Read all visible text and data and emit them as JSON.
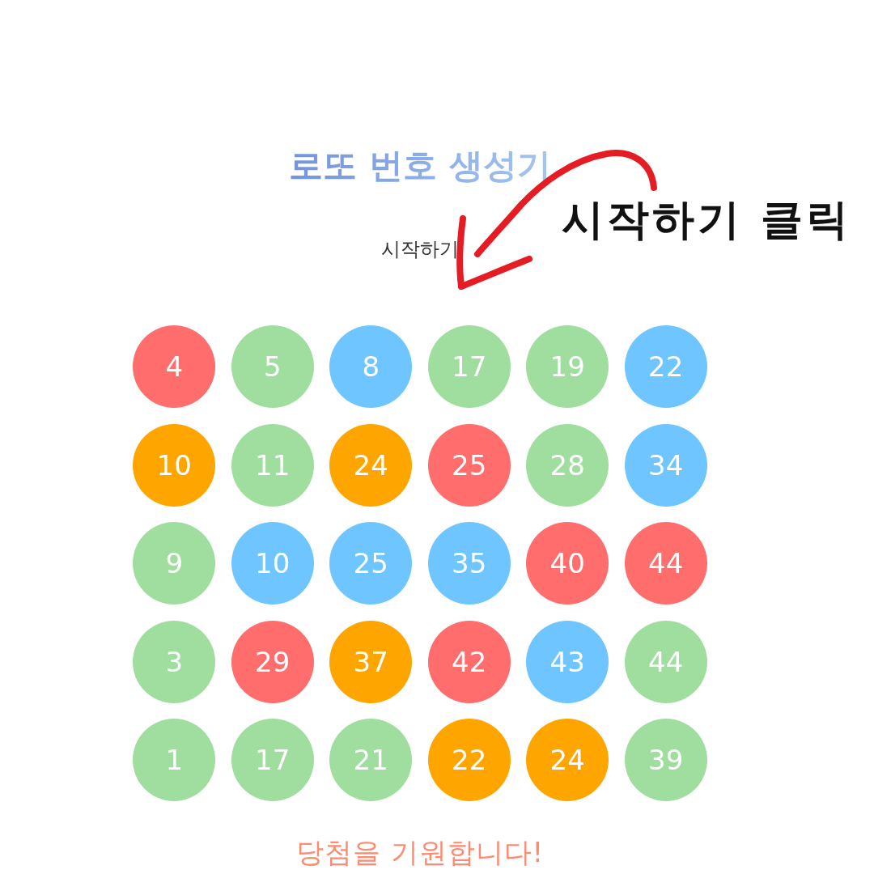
{
  "title": "로또 번호 생성기",
  "start_button": {
    "label": "시작하기"
  },
  "rows": [
    {
      "balls": [
        {
          "number": "4",
          "color": "#ff6d6d"
        },
        {
          "number": "5",
          "color": "#a0dea0"
        },
        {
          "number": "8",
          "color": "#6ec5ff"
        },
        {
          "number": "17",
          "color": "#a0dea0"
        },
        {
          "number": "19",
          "color": "#a0dea0"
        },
        {
          "number": "22",
          "color": "#6ec5ff"
        }
      ]
    },
    {
      "balls": [
        {
          "number": "10",
          "color": "#ffa500"
        },
        {
          "number": "11",
          "color": "#a0dea0"
        },
        {
          "number": "24",
          "color": "#ffa500"
        },
        {
          "number": "25",
          "color": "#ff6d6d"
        },
        {
          "number": "28",
          "color": "#a0dea0"
        },
        {
          "number": "34",
          "color": "#6ec5ff"
        }
      ]
    },
    {
      "balls": [
        {
          "number": "9",
          "color": "#a0dea0"
        },
        {
          "number": "10",
          "color": "#6ec5ff"
        },
        {
          "number": "25",
          "color": "#6ec5ff"
        },
        {
          "number": "35",
          "color": "#6ec5ff"
        },
        {
          "number": "40",
          "color": "#ff6d6d"
        },
        {
          "number": "44",
          "color": "#ff6d6d"
        }
      ]
    },
    {
      "balls": [
        {
          "number": "3",
          "color": "#a0dea0"
        },
        {
          "number": "29",
          "color": "#ff6d6d"
        },
        {
          "number": "37",
          "color": "#ffa500"
        },
        {
          "number": "42",
          "color": "#ff6d6d"
        },
        {
          "number": "43",
          "color": "#6ec5ff"
        },
        {
          "number": "44",
          "color": "#a0dea0"
        }
      ]
    },
    {
      "balls": [
        {
          "number": "1",
          "color": "#a0dea0"
        },
        {
          "number": "17",
          "color": "#a0dea0"
        },
        {
          "number": "21",
          "color": "#a0dea0"
        },
        {
          "number": "22",
          "color": "#ffa500"
        },
        {
          "number": "24",
          "color": "#ffa500"
        },
        {
          "number": "39",
          "color": "#a0dea0"
        }
      ]
    }
  ],
  "footer": "당첨을 기원합니다!",
  "annotation": {
    "text": "시작하기 클릭"
  }
}
